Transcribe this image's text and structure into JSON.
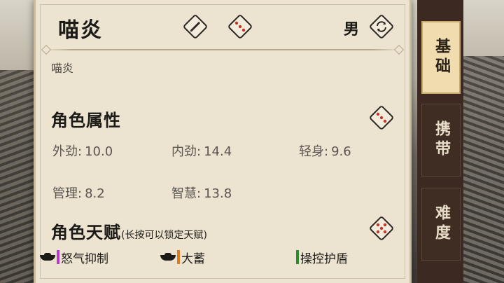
{
  "character": {
    "name": "喵炎",
    "nickname": "喵炎",
    "gender": "男"
  },
  "attributes": {
    "title": "角色属性",
    "stats": [
      {
        "label": "外劲:",
        "value": "10.0"
      },
      {
        "label": "内劲:",
        "value": "14.4"
      },
      {
        "label": "轻身:",
        "value": "9.6"
      },
      {
        "label": "管理:",
        "value": "8.2"
      },
      {
        "label": "智慧:",
        "value": "13.8"
      }
    ]
  },
  "talents": {
    "title": "角色天赋",
    "hint": "(长按可以锁定天赋)",
    "items": [
      {
        "name": "怒气抑制",
        "color": "#b43ccf"
      },
      {
        "name": "大蓄",
        "color": "#e07a1e"
      },
      {
        "name": "操控护盾",
        "color": "#2f8a2f"
      }
    ]
  },
  "tabs": [
    {
      "label": "基础",
      "active": true
    },
    {
      "label": "携带",
      "active": false
    },
    {
      "label": "难度",
      "active": false
    }
  ],
  "icons": {
    "edit": "brush-icon",
    "randomize": "dice-icon",
    "toggle_gender": "swap-icon"
  }
}
